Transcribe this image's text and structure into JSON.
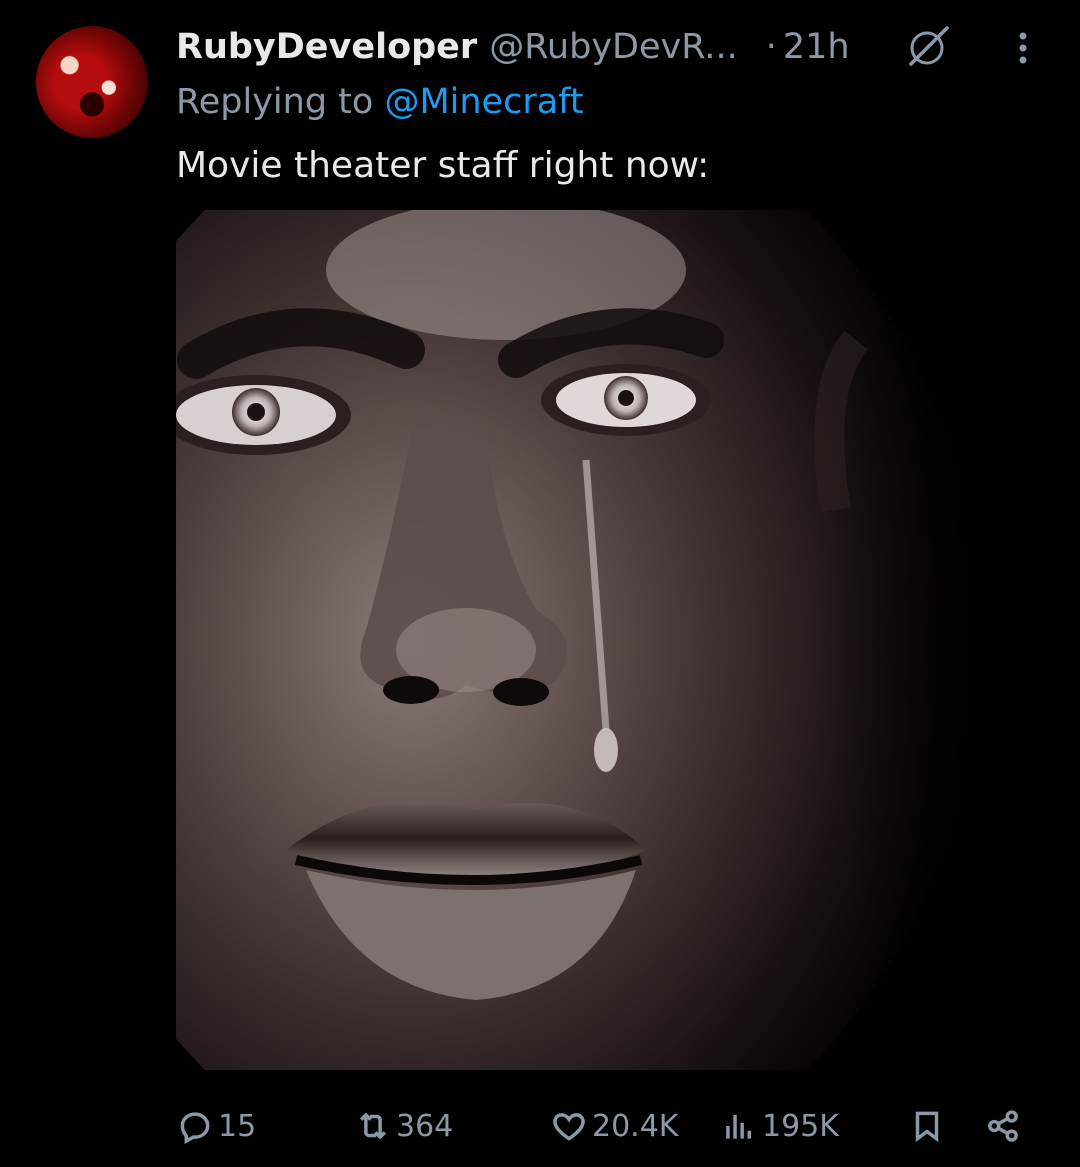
{
  "tweet": {
    "display_name": "RubyDeveloper",
    "handle": "@RubyDevR...",
    "separator": "·",
    "time": "21h",
    "replying_prefix": "Replying to ",
    "replying_to": "@Minecraft",
    "text": "Movie theater staff right now:"
  },
  "icons": {
    "avatar": "avatar-image",
    "grok": "grok-icon",
    "more": "more-options-icon",
    "reply": "reply-icon",
    "retweet": "retweet-icon",
    "like": "heart-icon",
    "views": "views-icon",
    "bookmark": "bookmark-icon",
    "share": "share-icon"
  },
  "actions": {
    "replies": "15",
    "retweets": "364",
    "likes": "20.4K",
    "views": "195K"
  },
  "colors": {
    "background": "#000000",
    "text": "#e7e9ea",
    "muted": "#8b98a5",
    "link": "#1d9bf0"
  }
}
